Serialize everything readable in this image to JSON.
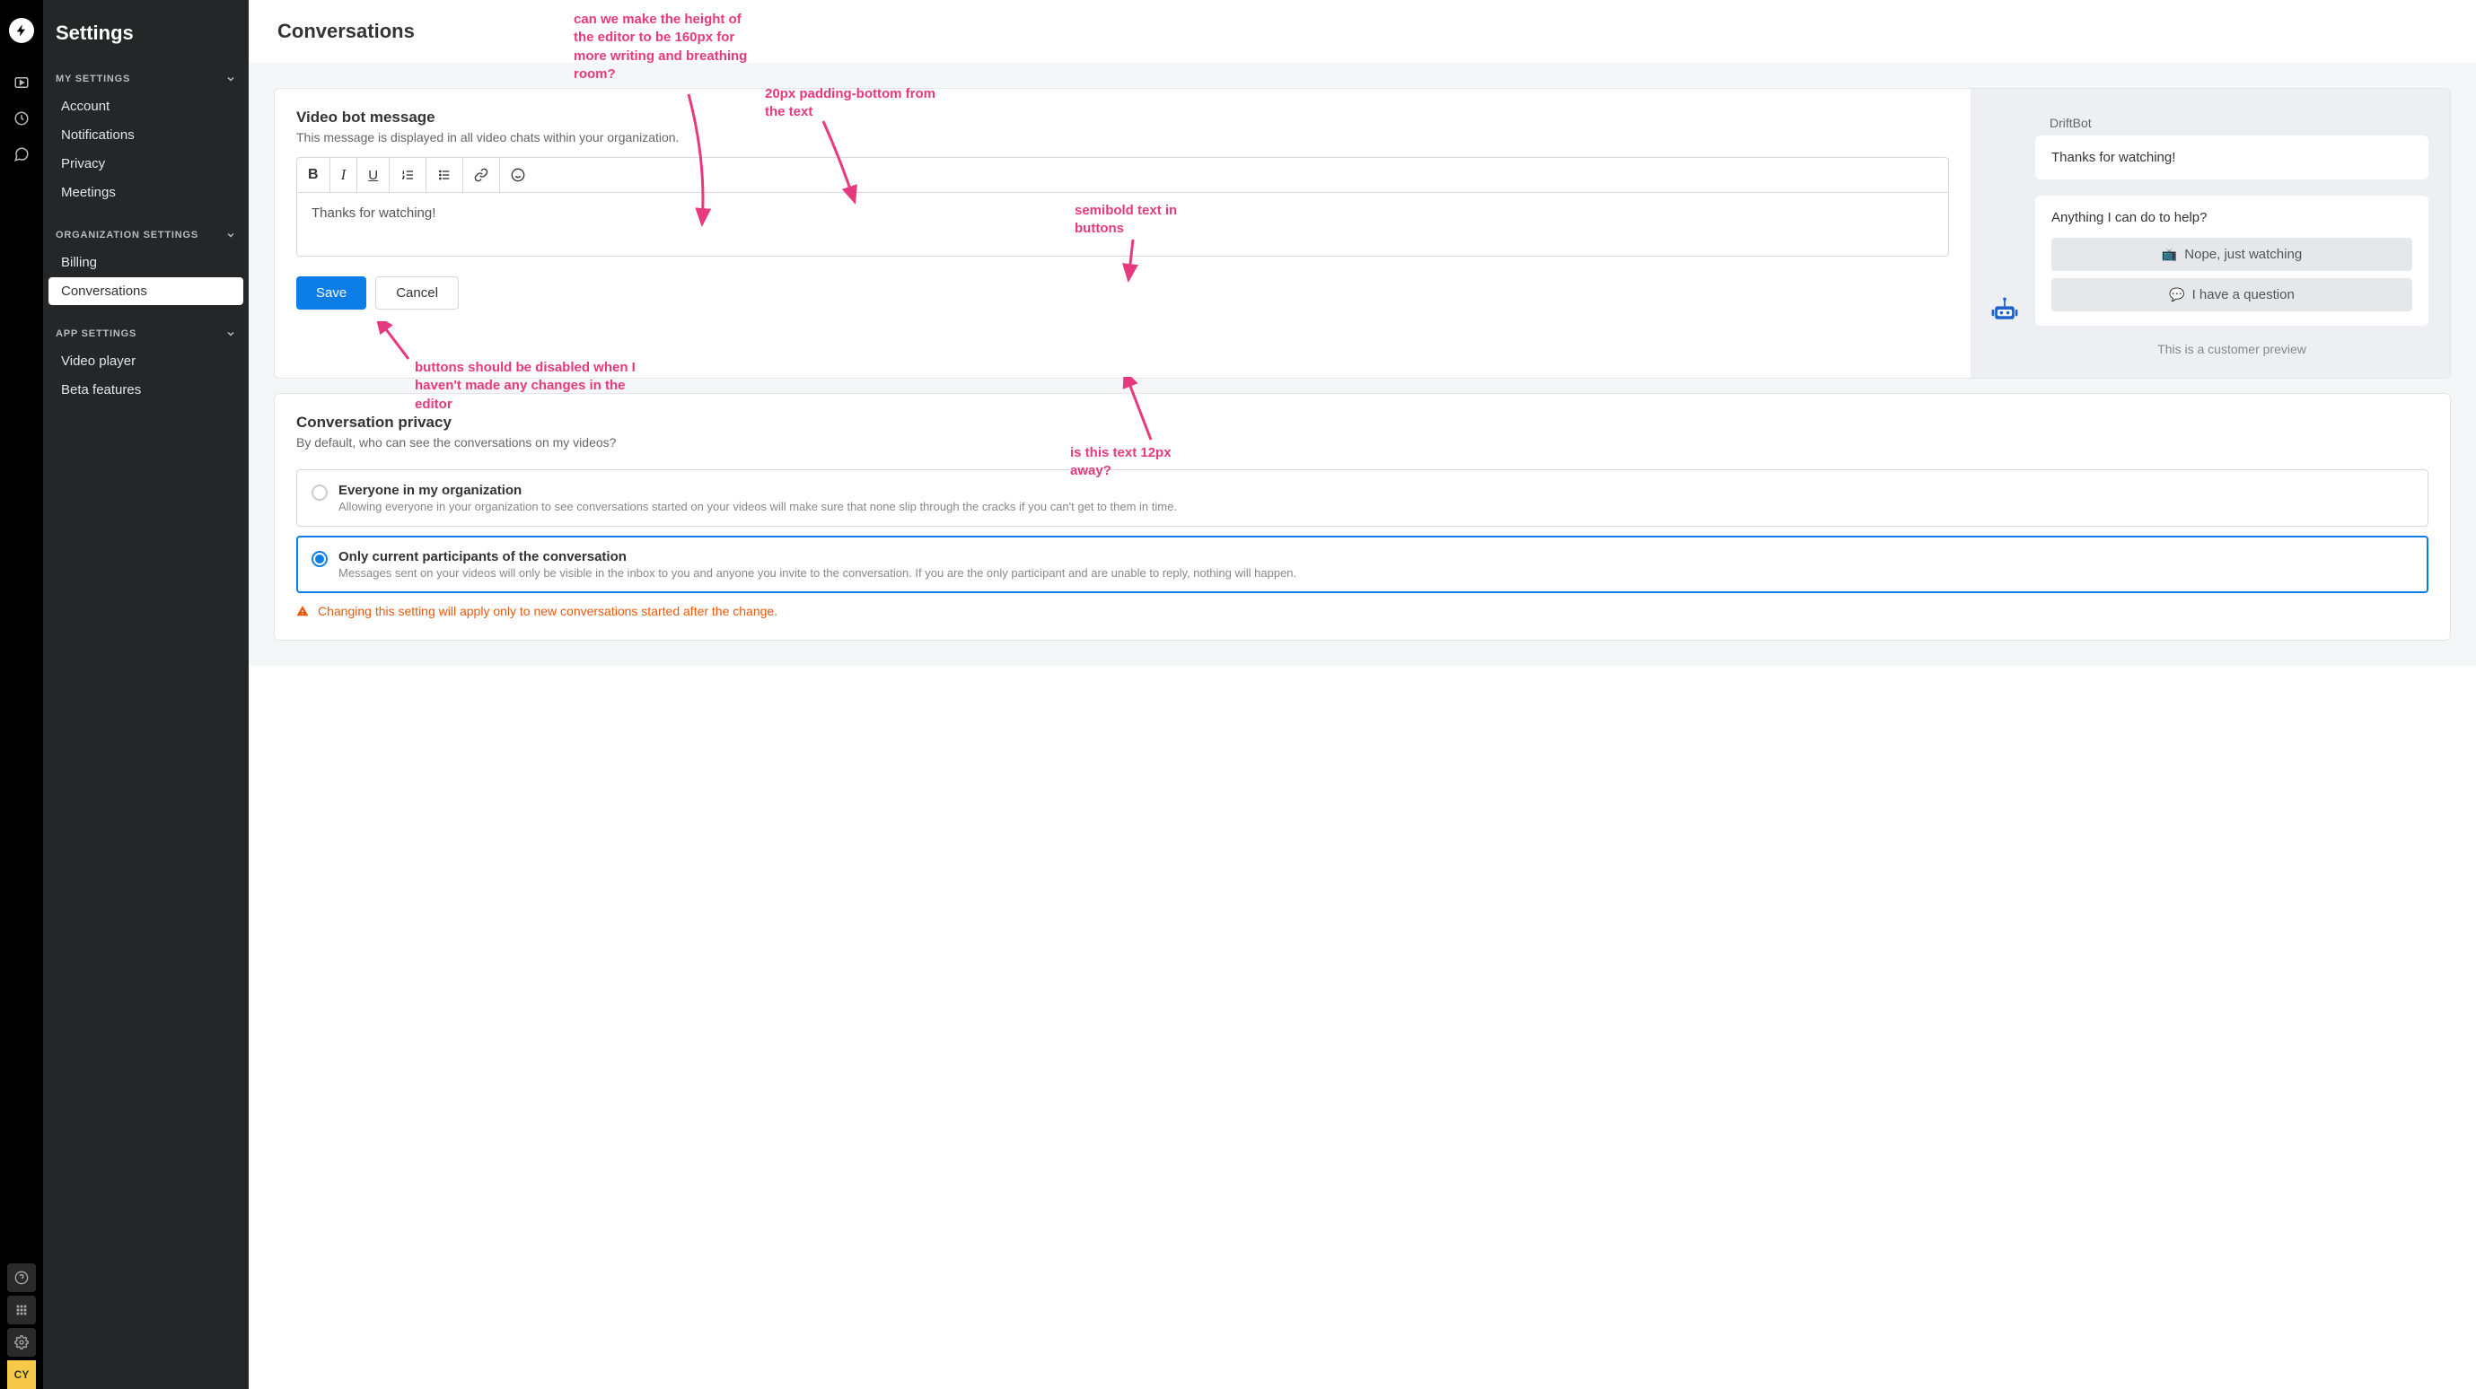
{
  "rail": {
    "avatar_initials": "CY"
  },
  "sidebar": {
    "title": "Settings",
    "sections": [
      {
        "heading": "MY SETTINGS",
        "items": [
          {
            "label": "Account"
          },
          {
            "label": "Notifications"
          },
          {
            "label": "Privacy"
          },
          {
            "label": "Meetings"
          }
        ]
      },
      {
        "heading": "ORGANIZATION SETTINGS",
        "items": [
          {
            "label": "Billing"
          },
          {
            "label": "Conversations"
          }
        ]
      },
      {
        "heading": "APP SETTINGS",
        "items": [
          {
            "label": "Video player"
          },
          {
            "label": "Beta features"
          }
        ]
      }
    ]
  },
  "main": {
    "title": "Conversations",
    "videobot": {
      "title": "Video bot message",
      "subtitle": "This message is displayed in all video chats within your organization.",
      "editor_content": "Thanks for watching!",
      "save_label": "Save",
      "cancel_label": "Cancel"
    },
    "preview": {
      "bot_name": "DriftBot",
      "message_1": "Thanks for watching!",
      "message_2": "Anything I can do to help?",
      "button_1": "Nope, just watching",
      "button_2": "I have a question",
      "caption": "This is a customer preview"
    },
    "privacy": {
      "title": "Conversation privacy",
      "subtitle": "By default, who can see the conversations on my videos?",
      "options": [
        {
          "label": "Everyone in my organization",
          "desc": "Allowing everyone in your organization to see conversations started on your videos will make sure that none slip through the cracks if you can't get to them in time."
        },
        {
          "label": "Only current participants of the conversation",
          "desc": "Messages sent on your videos will only be visible in the inbox to you and anyone you invite to the conversation. If you are the only participant and are unable to reply, nothing will happen."
        }
      ],
      "warning": "Changing this setting will apply only to new conversations started after the change."
    }
  },
  "annotations": {
    "a1": "can we make the height of the editor to be 160px for more writing and breathing room?",
    "a2": "20px padding-bottom from the text",
    "a3": "semibold text in buttons",
    "a4": "buttons should be disabled when I haven't made any changes in the editor",
    "a5": "is this text 12px away?"
  }
}
